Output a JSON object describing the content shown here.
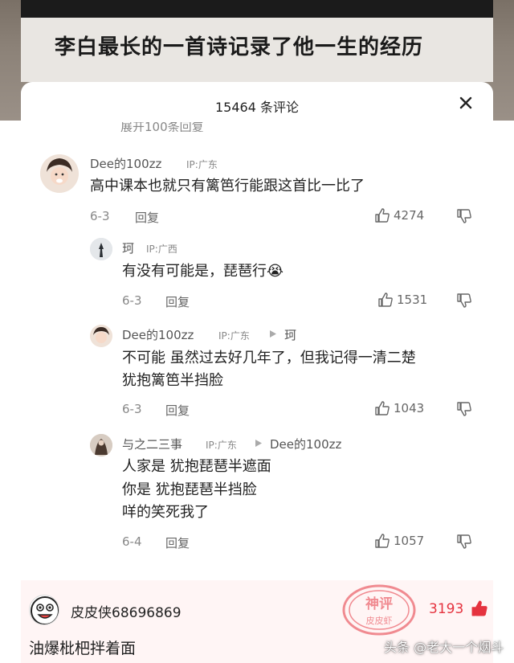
{
  "video": {
    "caption": "李白最长的一首诗记录了他一生的经历"
  },
  "sheet": {
    "title": "15464 条评论",
    "partial_text": "展开100条回复"
  },
  "comments": [
    {
      "username": "Dee的100zz",
      "ip": "IP:广东",
      "text": "高中课本也就只有篱笆行能跟这首比一比了",
      "date": "6-3",
      "reply_label": "回复",
      "likes": "4274"
    },
    {
      "username": "珂",
      "ip": "IP:广西",
      "text": "有没有可能是，琵琶行",
      "emoji": "😭",
      "date": "6-3",
      "reply_label": "回复",
      "likes": "1531"
    },
    {
      "username": "Dee的100zz",
      "ip": "IP:广东",
      "reply_to": "珂",
      "text_lines": [
        "不可能 虽然过去好几年了，但我记得一清二楚",
        "犹抱篱笆半挡脸"
      ],
      "date": "6-3",
      "reply_label": "回复",
      "likes": "1043"
    },
    {
      "username": "与之二三事",
      "ip": "IP:广东",
      "reply_to": "Dee的100zz",
      "text_lines": [
        "人家是 犹抱琵琶半遮面",
        "你是 犹抱琵琶半挡脸",
        "咩的笑死我了"
      ],
      "date": "6-4",
      "reply_label": "回复",
      "likes": "1057"
    }
  ],
  "featured": {
    "username": "皮皮侠68696869",
    "text": "油爆枇杷拌着面",
    "likes": "3193",
    "stamp_text": "神评",
    "stamp_sub": "皮皮虾"
  },
  "watermark": "头条 @老大一个烟斗",
  "colors": {
    "like_red": "#e5333f",
    "muted": "#888888",
    "text": "#222222"
  }
}
